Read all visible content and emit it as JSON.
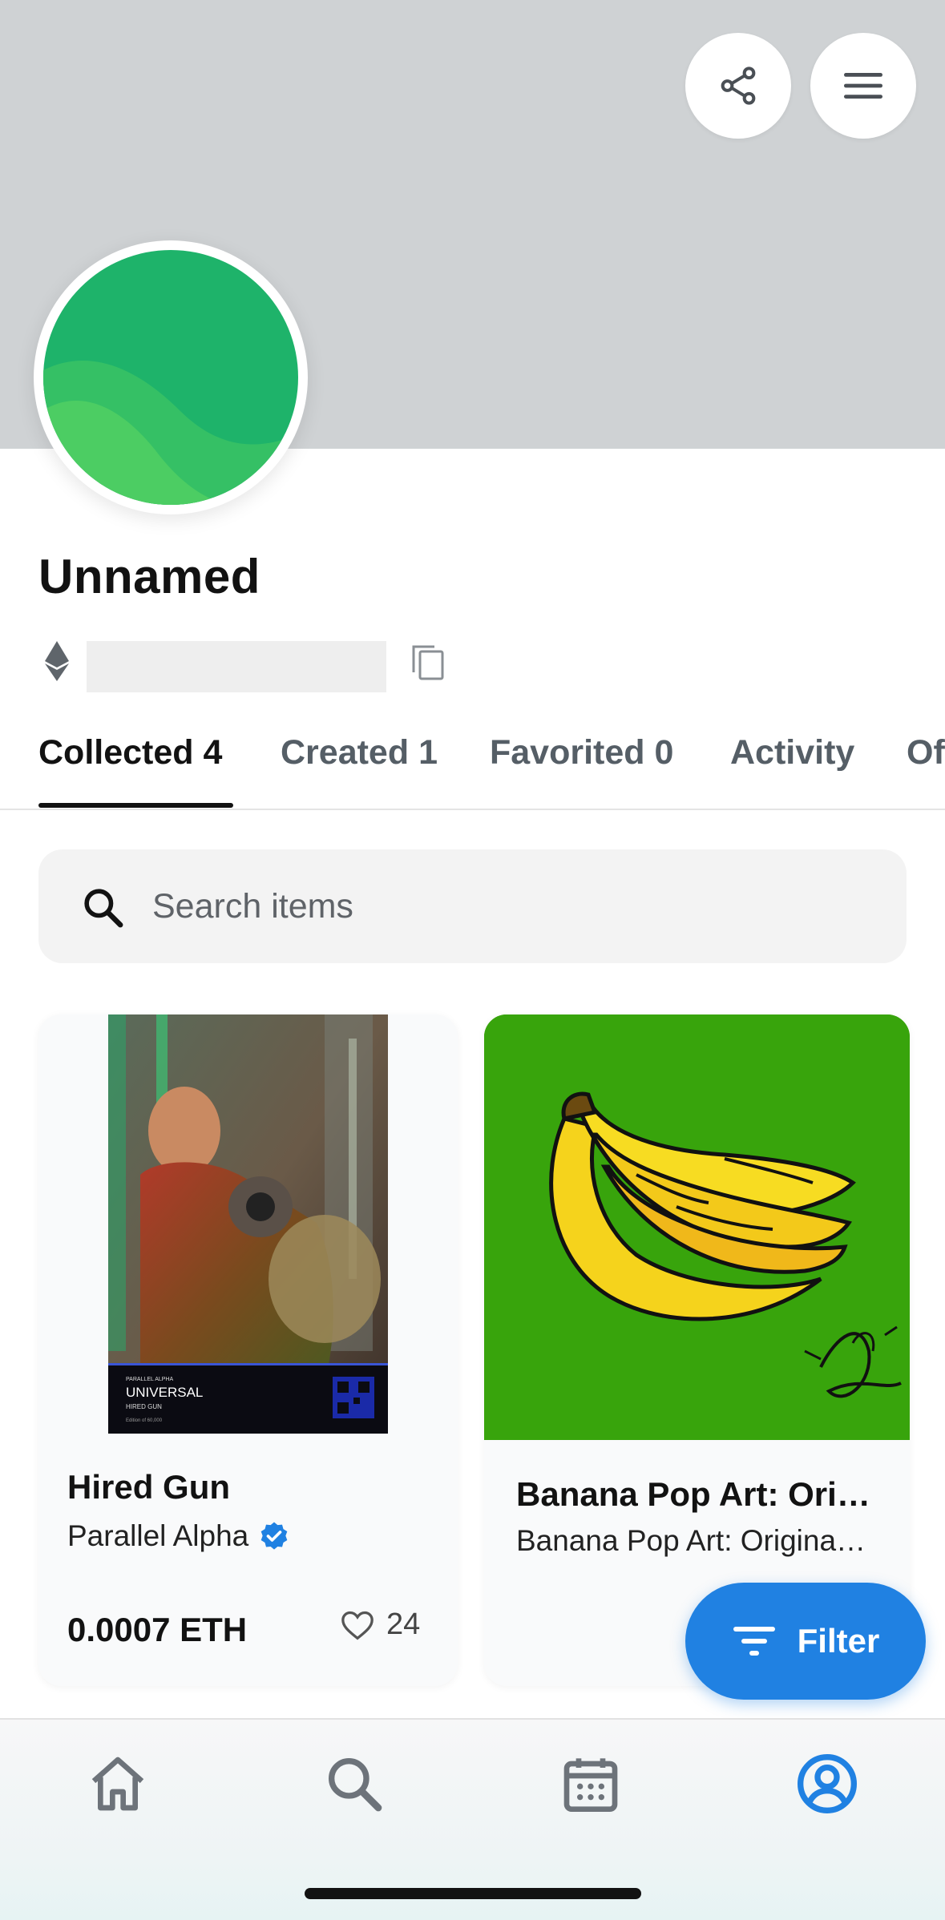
{
  "header": {
    "share_icon": "share-icon",
    "menu_icon": "hamburger-menu-icon"
  },
  "profile": {
    "name": "Unnamed",
    "chain_icon": "ethereum-icon",
    "copy_icon": "copy-icon"
  },
  "tabs": [
    {
      "label": "Collected 4",
      "active": true
    },
    {
      "label": "Created 1",
      "active": false
    },
    {
      "label": "Favorited 0",
      "active": false
    },
    {
      "label": "Activity",
      "active": false
    },
    {
      "label": "Of",
      "active": false
    }
  ],
  "search": {
    "placeholder": "Search items"
  },
  "items": [
    {
      "title": "Hired Gun",
      "collection": "Parallel Alpha",
      "verified": true,
      "price": "0.0007 ETH",
      "likes": "24",
      "art_text": {
        "brand": "PARALLEL ALPHA",
        "rarity": "UNIVERSAL",
        "name": "HIRED GUN",
        "edition": "Edition of 60,000"
      }
    },
    {
      "title": "Banana Pop Art: Ori…",
      "collection": "Banana Pop Art: Origina…"
    }
  ],
  "filter": {
    "label": "Filter"
  },
  "bottom_nav": [
    {
      "icon": "home-icon",
      "active": false
    },
    {
      "icon": "search-icon",
      "active": false
    },
    {
      "icon": "calendar-icon",
      "active": false
    },
    {
      "icon": "profile-icon",
      "active": true
    }
  ],
  "colors": {
    "accent": "#2081e2",
    "banner": "#cfd2d4",
    "avatar_green": "#1fb46a"
  }
}
